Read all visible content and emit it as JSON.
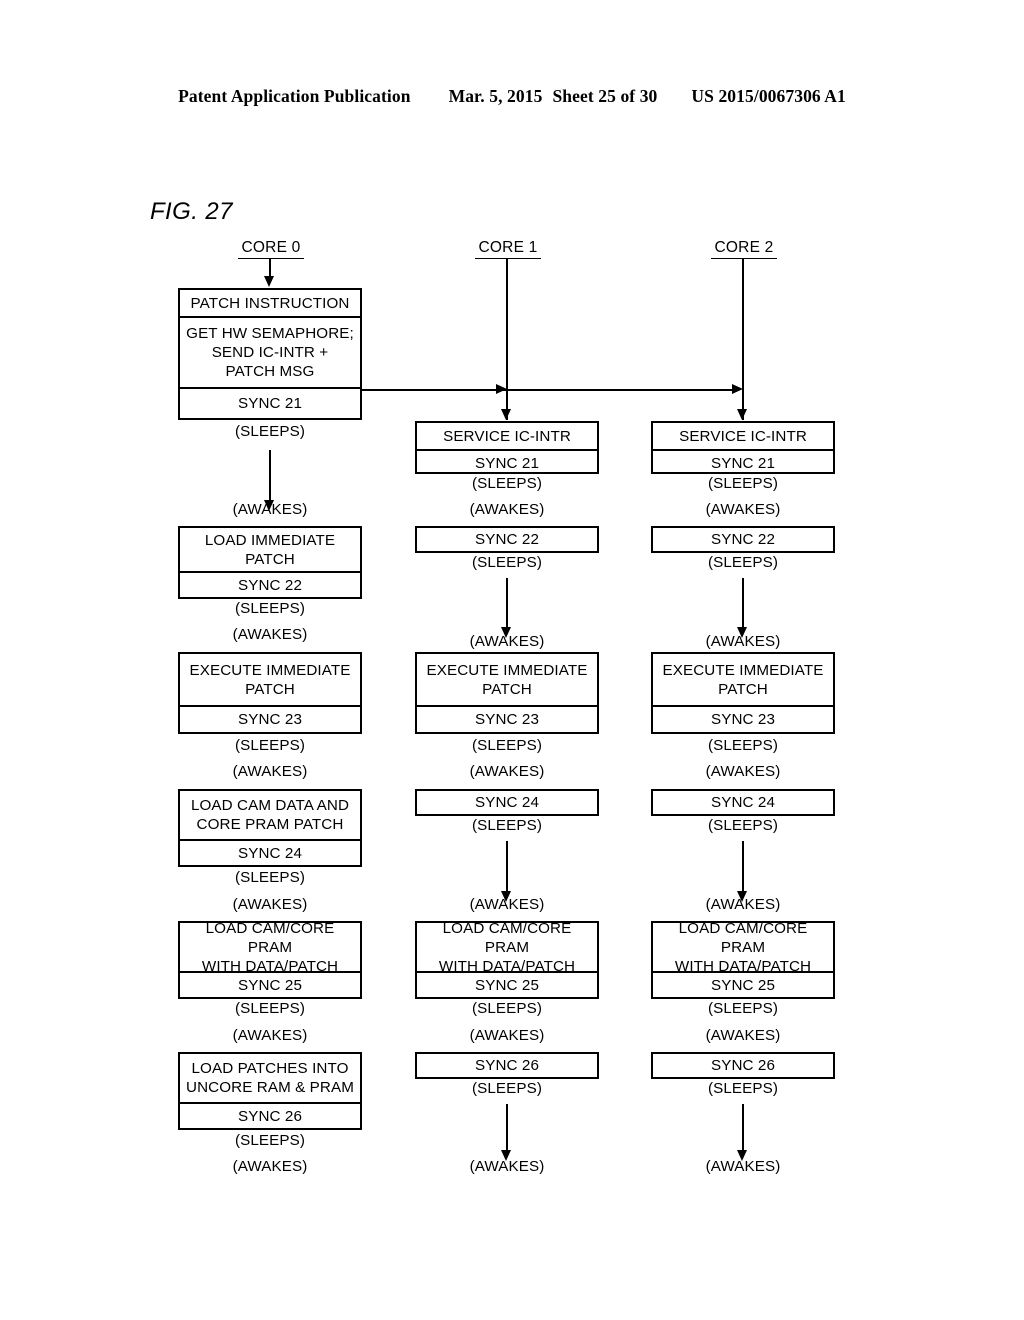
{
  "header": {
    "publication": "Patent Application Publication",
    "date": "Mar. 5, 2015",
    "sheet": "Sheet 25 of 30",
    "patent_number": "US 2015/0067306 A1"
  },
  "figure": {
    "label": "FIG. 27",
    "columns": [
      {
        "id": "core0",
        "title": "CORE 0"
      },
      {
        "id": "core1",
        "title": "CORE 1"
      },
      {
        "id": "core2",
        "title": "CORE 2"
      }
    ]
  },
  "core0": {
    "title": "CORE 0",
    "b1_c1": "PATCH INSTRUCTION",
    "b1_c2": "GET HW SEMAPHORE;\nSEND IC-INTR +\nPATCH MSG",
    "b1_c3": "SYNC 21",
    "s1": "(SLEEPS)",
    "a1": "(AWAKES)",
    "b2_c1": "LOAD IMMEDIATE PATCH",
    "b2_c2": "SYNC 22",
    "s2": "(SLEEPS)",
    "a2": "(AWAKES)",
    "b3_c1": "EXECUTE IMMEDIATE\nPATCH",
    "b3_c2": "SYNC 23",
    "s3": "(SLEEPS)",
    "a3": "(AWAKES)",
    "b4_c1": "LOAD CAM DATA AND\nCORE PRAM PATCH",
    "b4_c2": "SYNC 24",
    "s4": "(SLEEPS)",
    "a4": "(AWAKES)",
    "b5_c1": "LOAD CAM/CORE PRAM\nWITH DATA/PATCH",
    "b5_c2": "SYNC 25",
    "s5": "(SLEEPS)",
    "a5": "(AWAKES)",
    "b6_c1": "LOAD PATCHES INTO\nUNCORE RAM & PRAM",
    "b6_c2": "SYNC 26",
    "s6": "(SLEEPS)",
    "a6": "(AWAKES)"
  },
  "core1": {
    "title": "CORE 1",
    "b1_c1": "SERVICE IC-INTR",
    "b1_c2": "SYNC 21",
    "s1": "(SLEEPS)",
    "a1": "(AWAKES)",
    "b2_c1": "SYNC 22",
    "s2": "(SLEEPS)",
    "a2": "(AWAKES)",
    "b3_c1": "EXECUTE IMMEDIATE\nPATCH",
    "b3_c2": "SYNC 23",
    "s3": "(SLEEPS)",
    "a3": "(AWAKES)",
    "b4_c1": "SYNC 24",
    "s4": "(SLEEPS)",
    "a4": "(AWAKES)",
    "b5_c1": "LOAD CAM/CORE PRAM\nWITH DATA/PATCH",
    "b5_c2": "SYNC 25",
    "s5": "(SLEEPS)",
    "a5": "(AWAKES)",
    "b6_c1": "SYNC 26",
    "s6": "(SLEEPS)",
    "a6": "(AWAKES)"
  },
  "core2": {
    "title": "CORE 2",
    "b1_c1": "SERVICE IC-INTR",
    "b1_c2": "SYNC 21",
    "s1": "(SLEEPS)",
    "a1": "(AWAKES)",
    "b2_c1": "SYNC 22",
    "s2": "(SLEEPS)",
    "a2": "(AWAKES)",
    "b3_c1": "EXECUTE IMMEDIATE\nPATCH",
    "b3_c2": "SYNC 23",
    "s3": "(SLEEPS)",
    "a3": "(AWAKES)",
    "b4_c1": "SYNC 24",
    "s4": "(SLEEPS)",
    "a4": "(AWAKES)",
    "b5_c1": "LOAD CAM/CORE PRAM\nWITH DATA/PATCH",
    "b5_c2": "SYNC 25",
    "s5": "(SLEEPS)",
    "a5": "(AWAKES)",
    "b6_c1": "SYNC 26",
    "s6": "(SLEEPS)",
    "a6": "(AWAKES)"
  },
  "colors": {
    "ink": "#000000",
    "paper": "#ffffff"
  }
}
